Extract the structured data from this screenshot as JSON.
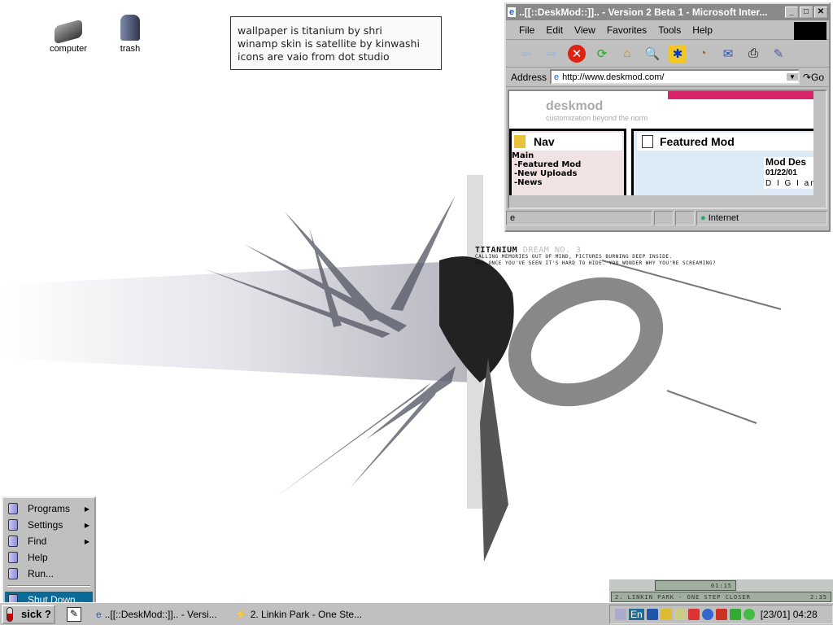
{
  "desktop": {
    "icons": [
      {
        "label": "computer"
      },
      {
        "label": "trash"
      }
    ],
    "note": [
      "wallpaper is titanium by shri",
      "winamp skin is satellite by kinwashi",
      "icons are vaio from dot studio"
    ],
    "wallpaper_text": {
      "title": "TITANIUM",
      "subtitle": "DREAM NO. 3",
      "line1": "CALLING MEMORIES OUT OF MIND, PICTURES BURNING DEEP INSIDE.",
      "line2": "AND ONCE YOU'VE SEEN IT'S HARD TO HIDE. YOU WONDER WHY YOU'RE SCREAMING?"
    }
  },
  "browser": {
    "title": "..[[::DeskMod::]].. - Version 2 Beta 1 - Microsoft Inter...",
    "menu": [
      "File",
      "Edit",
      "View",
      "Favorites",
      "Tools",
      "Help"
    ],
    "address_label": "Address",
    "url": "http://www.deskmod.com/",
    "go_label": "Go",
    "page": {
      "logo": "deskmod",
      "tagline": "customization beyond the norm",
      "nav_title": "Nav",
      "nav_items": [
        "Main",
        "-Featured Mod",
        "-New Uploads",
        "-News"
      ],
      "featured_title": "Featured Mod",
      "mod_title": "Mod Des",
      "mod_date": "01/22/01",
      "mod_text": "D I G I am"
    },
    "status_zone": "Internet"
  },
  "start_menu": {
    "items": [
      {
        "label": "Programs",
        "submenu": true
      },
      {
        "label": "Settings",
        "submenu": true
      },
      {
        "label": "Find",
        "submenu": true
      },
      {
        "label": "Help"
      },
      {
        "label": "Run..."
      }
    ],
    "shutdown": "Shut Down..."
  },
  "taskbar": {
    "start_label": "sick ?",
    "tasks": [
      "..[[::DeskMod::]].. - Versi...",
      "2. Linkin Park  - One Ste..."
    ],
    "lang": "En",
    "clock": "[23/01] 04:28"
  },
  "winamp": {
    "time": "01:15",
    "track": "2. LINKIN PARK  -  ONE STEP CLOSER",
    "length": "2:35"
  },
  "colors": {
    "selection": "#0a6b99",
    "face": "#c0c0c0",
    "titlebar": "#8a8a8a"
  }
}
